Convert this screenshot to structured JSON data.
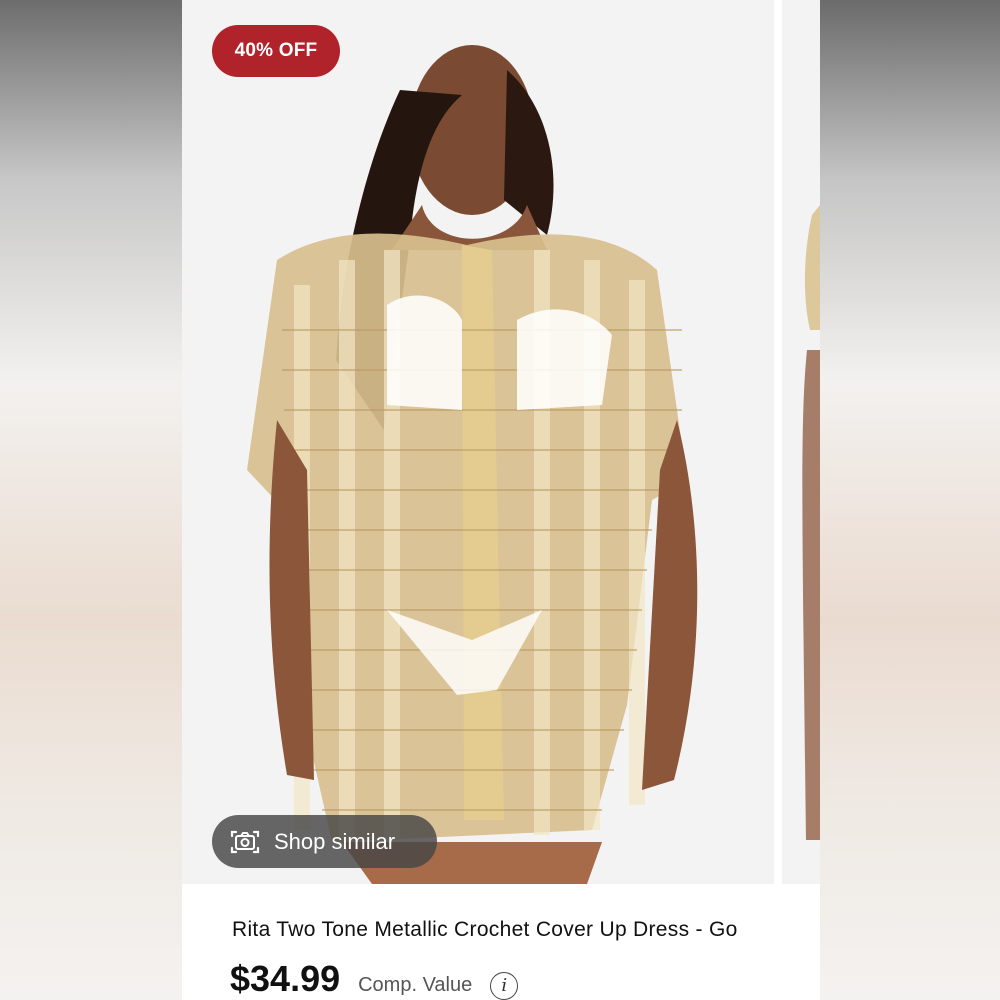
{
  "product_card": {
    "discount_badge": "40% OFF",
    "shop_similar_label": "Shop similar",
    "title": "Rita Two Tone Metallic Crochet Cover Up Dress - Go",
    "price": "$34.99",
    "comparison_label": "Comp. Value",
    "info_symbol": "i"
  },
  "icons": {
    "shop_similar": "camera-scan-icon",
    "comparison_info": "info-icon"
  },
  "colors": {
    "badge_background": "#b1232b",
    "badge_text": "#ffffff",
    "shop_similar_background": "#464646",
    "text_primary": "#111111"
  }
}
